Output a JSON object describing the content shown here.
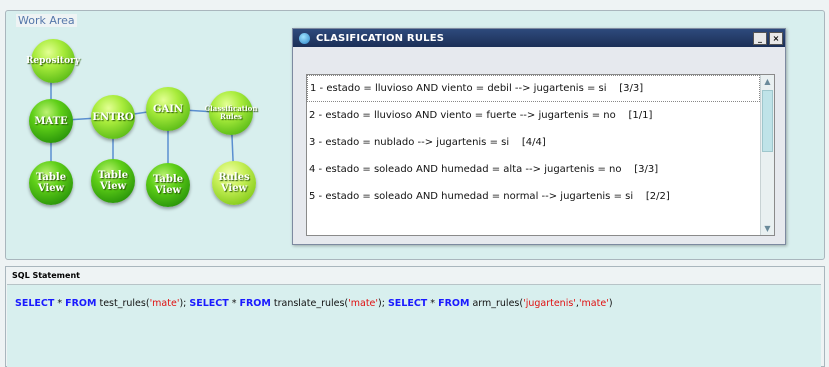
{
  "work_area": {
    "label": "Work Area"
  },
  "graph": {
    "nodes": {
      "repository": "Repository",
      "mate": "MATE",
      "entro": "ENTRO",
      "gain": "GAIN",
      "classification": "Classification Rules",
      "table_view_1": "Table View",
      "table_view_2": "Table View",
      "table_view_3": "Table View",
      "rules_view": "Rules View"
    }
  },
  "dialog": {
    "title": "CLASIFICATION RULES",
    "controls": {
      "minimize": "_",
      "close": "×"
    },
    "rules": [
      "1 - estado = lluvioso AND viento = debil --> jugartenis = si    [3/3]",
      "2 - estado = lluvioso AND viento = fuerte --> jugartenis = no    [1/1]",
      "3 - estado = nublado --> jugartenis = si    [4/4]",
      "4 - estado = soleado AND humedad = alta --> jugartenis = no    [3/3]",
      "5 - estado = soleado AND humedad = normal --> jugartenis = si    [2/2]"
    ]
  },
  "sql": {
    "label": "SQL Statement",
    "tokens": [
      {
        "text": "SELECT",
        "style": "kw"
      },
      {
        "text": " * ",
        "style": "plain"
      },
      {
        "text": "FROM",
        "style": "kw"
      },
      {
        "text": " test_rules(",
        "style": "plain"
      },
      {
        "text": "'mate'",
        "style": "str"
      },
      {
        "text": "); ",
        "style": "plain"
      },
      {
        "text": "SELECT",
        "style": "kw"
      },
      {
        "text": " * ",
        "style": "plain"
      },
      {
        "text": "FROM",
        "style": "kw"
      },
      {
        "text": " translate_rules(",
        "style": "plain"
      },
      {
        "text": "'mate'",
        "style": "str"
      },
      {
        "text": "); ",
        "style": "plain"
      },
      {
        "text": "SELECT",
        "style": "kw"
      },
      {
        "text": " * ",
        "style": "plain"
      },
      {
        "text": "FROM",
        "style": "kw"
      },
      {
        "text": " arm_rules(",
        "style": "plain"
      },
      {
        "text": "'jugartenis'",
        "style": "str"
      },
      {
        "text": ",",
        "style": "plain"
      },
      {
        "text": "'mate'",
        "style": "str"
      },
      {
        "text": ")",
        "style": "plain"
      }
    ]
  }
}
